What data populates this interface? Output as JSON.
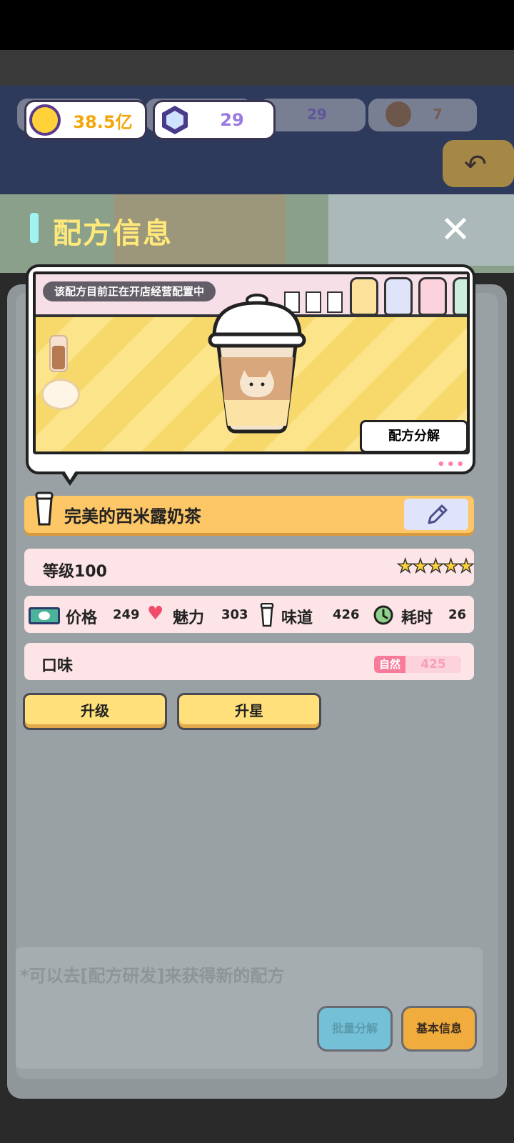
{
  "currency": {
    "gold": "38.5亿",
    "gems": "29",
    "bg_gems": "29",
    "bg_item": "7"
  },
  "title": "配方信息",
  "close_glyph": "✕",
  "preview": {
    "notice": "该配方目前正在开店经营配置中",
    "decompose_button": "配方分解",
    "more_dots": "•••"
  },
  "recipe": {
    "name": "完美的西米露奶茶",
    "level": "等级100",
    "stars": "★★★★★",
    "star_count": 5,
    "stats": [
      {
        "label": "价格",
        "value": "249",
        "icon": "cash-icon"
      },
      {
        "label": "魅力",
        "value": "303",
        "icon": "heart-icon"
      },
      {
        "label": "味道",
        "value": "426",
        "icon": "cup-icon"
      },
      {
        "label": "耗时",
        "value": "26",
        "icon": "clock-icon"
      }
    ],
    "flavor_label": "口味",
    "flavor_tag": "自然",
    "flavor_value": "425"
  },
  "actions": {
    "upgrade": "升级",
    "star_up": "升星"
  },
  "background": {
    "hint": "*可以去[配方研发]来获得新的配方",
    "batch_decompose": "批量分解",
    "basic_info": "基本信息"
  },
  "colors": {
    "title": "#ffe97a",
    "name_bar": "#fdc767",
    "info_row": "#fde4e6",
    "button": "#ffe07a",
    "flavor_tag": "#f87c9a"
  }
}
